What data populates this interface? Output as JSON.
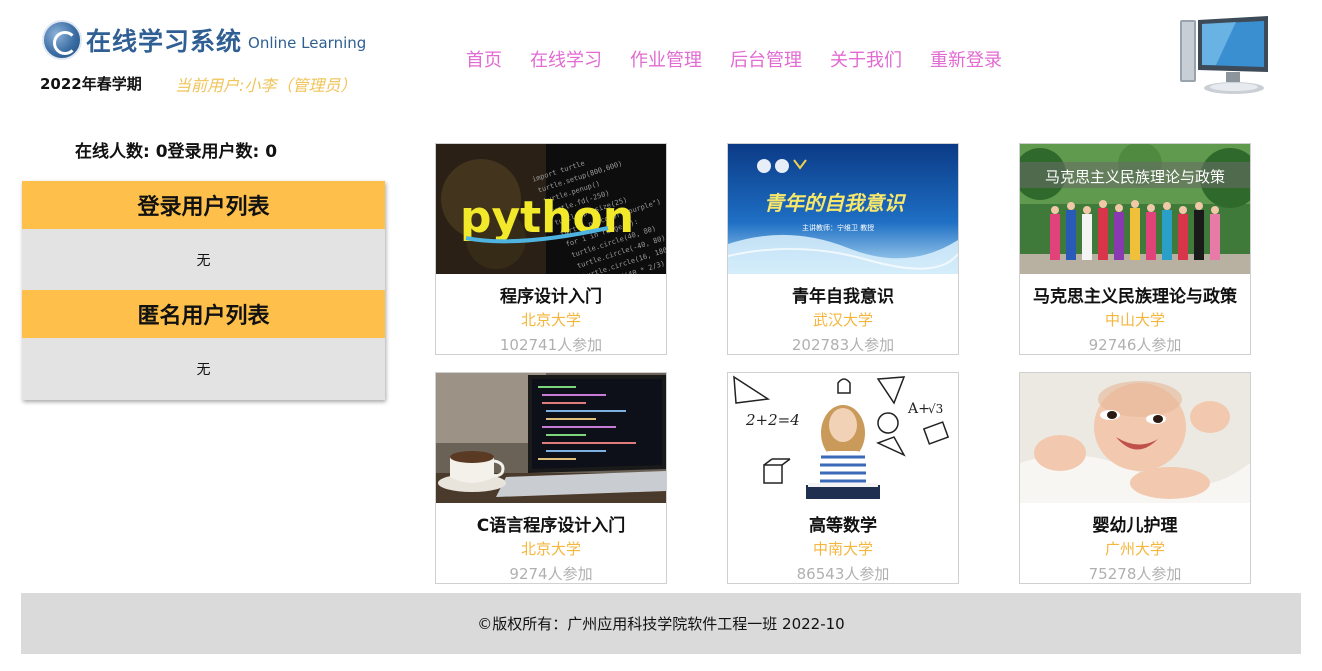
{
  "header": {
    "logo_title": "在线学习系统",
    "logo_subtitle": "Online Learning",
    "semester": "2022年春学期",
    "current_user": "当前用户:小李（管理员）"
  },
  "nav": {
    "items": [
      {
        "label": "首页"
      },
      {
        "label": "在线学习"
      },
      {
        "label": "作业管理"
      },
      {
        "label": "后台管理"
      },
      {
        "label": "关于我们"
      },
      {
        "label": "重新登录"
      }
    ]
  },
  "sidebar": {
    "online_stats": "在线人数: 0登录用户数: 0",
    "logged_in_title": "登录用户列表",
    "logged_in_empty": "无",
    "anonymous_title": "匿名用户列表",
    "anonymous_empty": "无"
  },
  "courses": [
    {
      "title": "程序设计入门",
      "school": "北京大学",
      "participants": "102741人参加",
      "image": "python-code-image",
      "image_text": "python"
    },
    {
      "title": "青年自我意识",
      "school": "武汉大学",
      "participants": "202783人参加",
      "image": "lecture-banner-image",
      "image_text": "青年的自我意识",
      "image_caption": "主讲教师：宁维卫 教授"
    },
    {
      "title": "马克思主义民族理论与政策",
      "school": "中山大学",
      "participants": "92746人参加",
      "image": "ethnic-costume-group-image",
      "image_text": "马克思主义民族理论与政策"
    },
    {
      "title": "C语言程序设计入门",
      "school": "北京大学",
      "participants": "9274人参加",
      "image": "laptop-coffee-image"
    },
    {
      "title": "高等数学",
      "school": "中南大学",
      "participants": "86543人参加",
      "image": "girl-math-doodle-image",
      "image_text": "2+2=4"
    },
    {
      "title": "婴幼儿护理",
      "school": "广州大学",
      "participants": "75278人参加",
      "image": "smiling-baby-image"
    }
  ],
  "footer": {
    "copyright": "©版权所有：广州应用科技学院软件工程一班 2022-10"
  },
  "colors": {
    "nav_link": "#e26ad2",
    "accent_orange": "#fec04a",
    "school_text": "#f4b63c",
    "logo_blue": "#2f5f93",
    "count_gray": "#b0b0b0",
    "footer_bg": "#dadada"
  }
}
